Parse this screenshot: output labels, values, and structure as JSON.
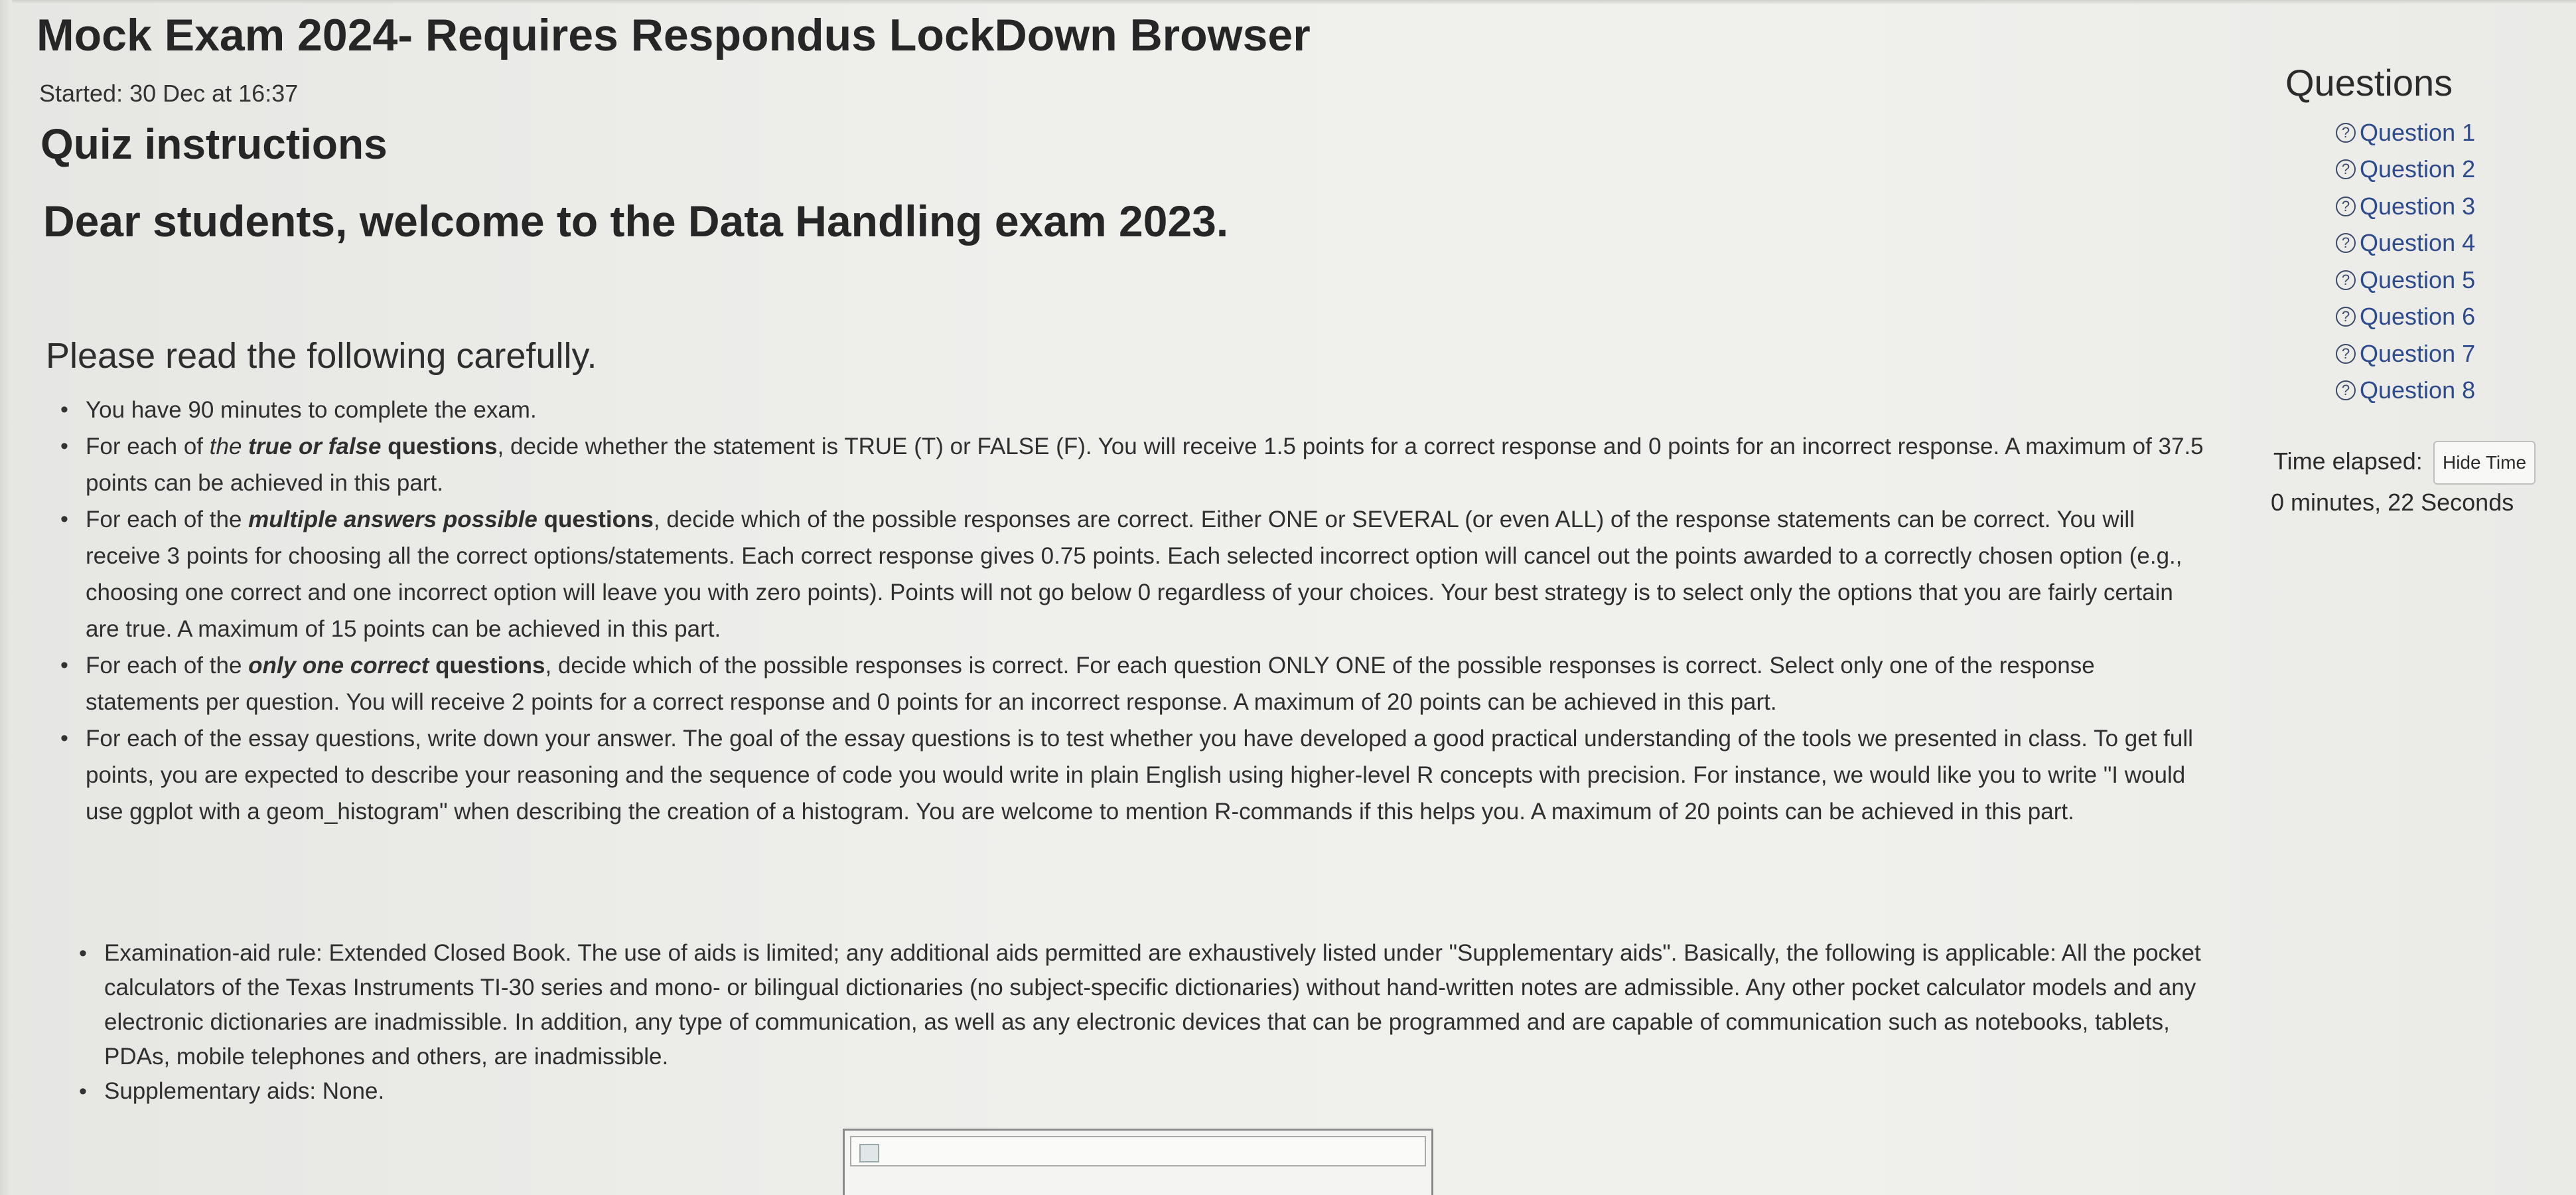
{
  "header": {
    "title": "Mock Exam 2024- Requires Respondus LockDown Browser",
    "started": "Started: 30 Dec at 16:37"
  },
  "instructions": {
    "heading": "Quiz instructions",
    "welcome": "Dear students, welcome to the Data Handling exam 2023.",
    "please_read": "Please read the following carefully.",
    "rules": [
      {
        "text": "You have 90 minutes to complete the exam."
      },
      {
        "pre": "For each of ",
        "em_italic": "the",
        "em_bold_italic": " true or false",
        "em_bold": " questions",
        "post": ", decide whether the statement is TRUE (T) or FALSE (F). You will receive 1.5 points for a correct response and 0 points for an incorrect response. A maximum of 37.5 points can be achieved in this part."
      },
      {
        "pre": "For each of the ",
        "em_bold_italic": "multiple answers possible",
        "em_bold": " questions",
        "post": ", decide which of the possible responses are correct. Either ONE or SEVERAL (or even ALL) of the response statements can be correct. You will receive 3 points for choosing all the correct options/statements. Each correct response gives 0.75 points. Each selected incorrect option will cancel out the points awarded to a correctly chosen option (e.g., choosing one correct and one incorrect option will leave you with zero points). Points will not go below 0 regardless of your choices. Your best strategy is to select only the options that you are fairly certain are true. A maximum of 15 points can be achieved in this part."
      },
      {
        "pre": "For each of the ",
        "em_bold_italic": "only one correct",
        "em_bold": " questions",
        "post": ", decide which of the possible responses is correct. For each question ONLY ONE of the possible responses is correct. Select only one of the response statements per question. You will receive 2 points for a correct response and 0 points for an incorrect response. A maximum of 20 points can be achieved in this part."
      },
      {
        "text": "For each of the essay questions, write down your answer. The goal of the essay questions is to test whether you have developed a good practical understanding of the tools we presented in class. To get full points, you are expected to describe your reasoning and the sequence of code you would write in plain English using higher-level R concepts with precision. For instance, we would like you to write \"I would use ggplot with a geom_histogram\" when describing the creation of a histogram. You are welcome to mention R-commands if this helps you. A maximum of 20 points can be achieved in this part."
      }
    ],
    "rules2": [
      "Examination-aid rule: Extended Closed Book. The use of aids is limited; any additional aids permitted are exhaustively listed under \"Supplementary aids\". Basically, the following is applicable: All the pocket calculators of the Texas Instruments TI-30 series and mono- or bilingual dictionaries (no subject-specific dictionaries) without hand-written notes are admissible. Any other pocket calculator models and any electronic dictionaries are inadmissible. In addition, any type of communication, as well as any electronic devices that can be programmed and are capable of communication such as notebooks, tablets, PDAs, mobile telephones and others, are inadmissible.",
      "Supplementary aids: None."
    ]
  },
  "sidebar": {
    "heading": "Questions",
    "icon": "question-circle-icon",
    "questions": [
      "Question 1",
      "Question 2",
      "Question 3",
      "Question 4",
      "Question 5",
      "Question 6",
      "Question 7",
      "Question 8"
    ],
    "time_label": "Time elapsed:",
    "hide_time_label": "Hide Time",
    "time_value": "0 minutes, 22 Seconds"
  },
  "colors": {
    "link": "#2d4a8a",
    "text": "#2b2b2b",
    "background": "#efefec"
  }
}
